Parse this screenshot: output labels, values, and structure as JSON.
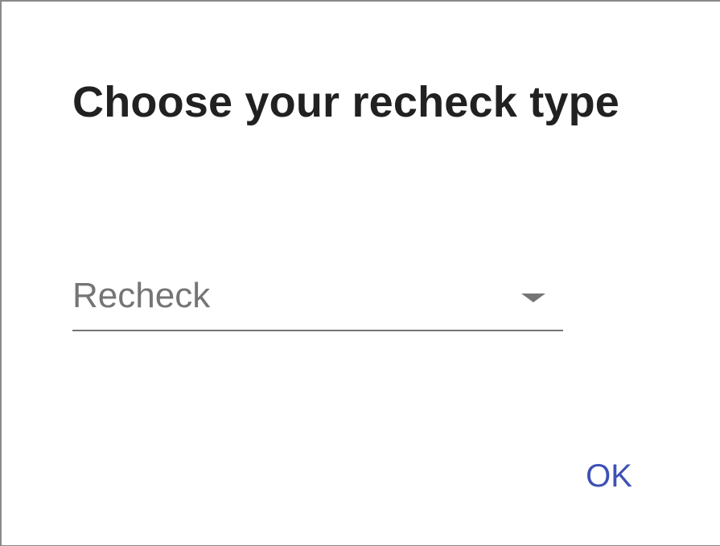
{
  "dialog": {
    "title": "Choose your recheck type",
    "select": {
      "value": "Recheck",
      "icon": "dropdown-arrow-icon"
    },
    "ok_label": "OK"
  },
  "colors": {
    "title": "#212121",
    "select_text": "#757575",
    "underline": "#757575",
    "accent": "#3f51b5",
    "background": "#ffffff"
  }
}
